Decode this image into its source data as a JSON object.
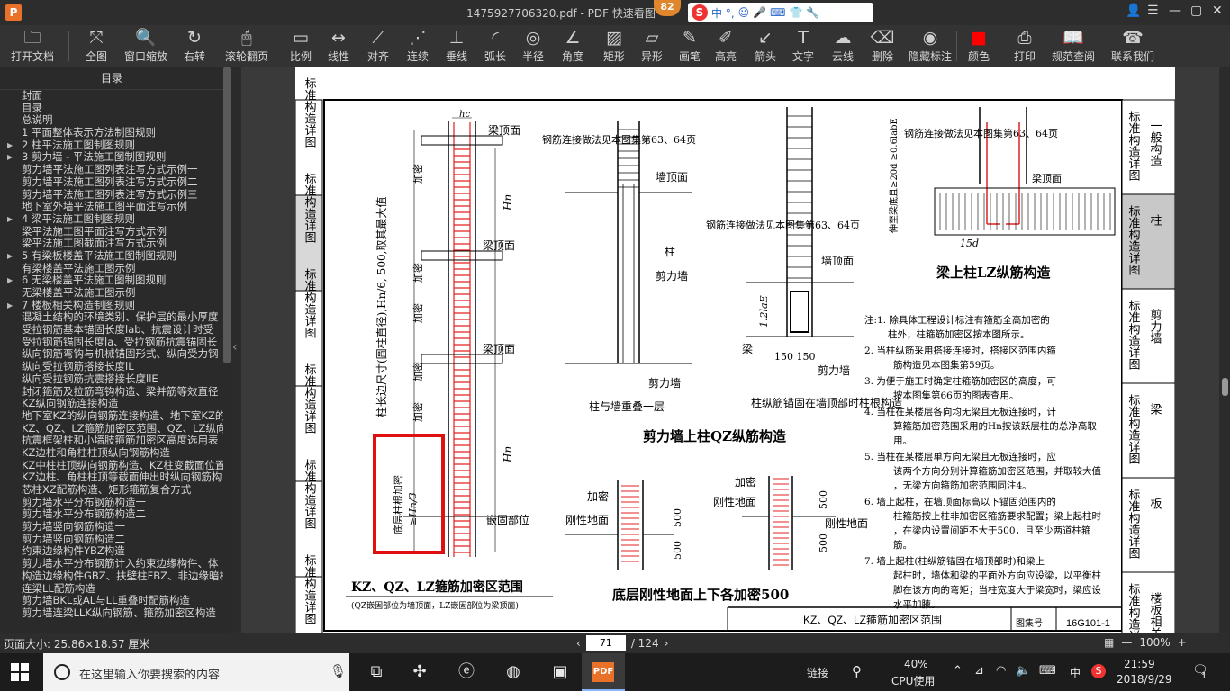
{
  "titlebar": {
    "app_letter": "P",
    "title": "1475927706320.pdf - PDF 快速看图",
    "badge": "82",
    "ime_logo": "S",
    "ime_text": "中 °,"
  },
  "toolbar": {
    "items": [
      {
        "label": "打开文档",
        "icon": "folder-icon",
        "glyph": "🗀"
      },
      {
        "label": "全图",
        "icon": "fit-page-icon",
        "glyph": "⤧"
      },
      {
        "label": "窗口缩放",
        "icon": "zoom-icon",
        "glyph": "🔍"
      },
      {
        "label": "右转",
        "icon": "rotate-right-icon",
        "glyph": "↻"
      },
      {
        "label": "滚轮翻页",
        "icon": "mouse-wheel-icon",
        "glyph": "🖱"
      },
      {
        "label": "比例",
        "icon": "scale-icon",
        "glyph": "▭"
      },
      {
        "label": "线性",
        "icon": "linear-icon",
        "glyph": "↔"
      },
      {
        "label": "对齐",
        "icon": "align-icon",
        "glyph": "⟋"
      },
      {
        "label": "连续",
        "icon": "continuous-icon",
        "glyph": "⋰"
      },
      {
        "label": "垂线",
        "icon": "perpendicular-icon",
        "glyph": "⊥"
      },
      {
        "label": "弧长",
        "icon": "arc-length-icon",
        "glyph": "◜"
      },
      {
        "label": "半径",
        "icon": "radius-icon",
        "glyph": "◎"
      },
      {
        "label": "角度",
        "icon": "angle-icon",
        "glyph": "∠"
      },
      {
        "label": "矩形",
        "icon": "rectangle-icon",
        "glyph": "▨"
      },
      {
        "label": "异形",
        "icon": "irregular-shape-icon",
        "glyph": "▱"
      },
      {
        "label": "画笔",
        "icon": "pen-icon",
        "glyph": "✎"
      },
      {
        "label": "高亮",
        "icon": "highlighter-icon",
        "glyph": "✐"
      },
      {
        "label": "箭头",
        "icon": "arrow-icon",
        "glyph": "↙"
      },
      {
        "label": "文字",
        "icon": "text-icon",
        "glyph": "T"
      },
      {
        "label": "云线",
        "icon": "cloud-line-icon",
        "glyph": "☁"
      },
      {
        "label": "删除",
        "icon": "eraser-icon",
        "glyph": "⌫"
      },
      {
        "label": "隐藏标注",
        "icon": "hide-annotation-icon",
        "glyph": "◉"
      },
      {
        "label": "颜色",
        "icon": "color-icon",
        "glyph": "■"
      },
      {
        "label": "打印",
        "icon": "print-icon",
        "glyph": "⎙"
      },
      {
        "label": "规范查阅",
        "icon": "book-icon",
        "glyph": "📖"
      },
      {
        "label": "联系我们",
        "icon": "support-icon",
        "glyph": "☎"
      }
    ],
    "color_swatch": "#ff0000"
  },
  "sidebar": {
    "heading": "目录",
    "items": [
      {
        "label": "封面",
        "arrow": ""
      },
      {
        "label": "目录",
        "arrow": ""
      },
      {
        "label": "总说明",
        "arrow": ""
      },
      {
        "label": "1 平面整体表示方法制图规则",
        "arrow": ""
      },
      {
        "label": "2 柱平法施工图制图规则",
        "arrow": "▶"
      },
      {
        "label": "3 剪力墙 - 平法施工图制图规则",
        "arrow": "▶"
      },
      {
        "label": "剪力墙平法施工图列表注写方式示例一",
        "arrow": ""
      },
      {
        "label": "剪力墙平法施工图列表注写方式示例二",
        "arrow": ""
      },
      {
        "label": "剪力墙平法施工图列表注写方式示例三",
        "arrow": ""
      },
      {
        "label": "地下室外墙平法施工图平面注写示例",
        "arrow": ""
      },
      {
        "label": "4 梁平法施工图制图规则",
        "arrow": "▶"
      },
      {
        "label": "梁平法施工图平面注写方式示例",
        "arrow": ""
      },
      {
        "label": "梁平法施工图截面注写方式示例",
        "arrow": ""
      },
      {
        "label": "5 有梁板楼盖平法施工图制图规则",
        "arrow": "▶"
      },
      {
        "label": "有梁楼盖平法施工图示例",
        "arrow": ""
      },
      {
        "label": "6 无梁楼盖平法施工图制图规则",
        "arrow": "▶"
      },
      {
        "label": "无梁楼盖平法施工图示例",
        "arrow": ""
      },
      {
        "label": "7 楼板相关构造制图规则",
        "arrow": "▶"
      },
      {
        "label": "混凝土结构的环境类别、保护层的最小厚度",
        "arrow": ""
      },
      {
        "label": "受拉钢筋基本锚固长度lab、抗震设计时受",
        "arrow": ""
      },
      {
        "label": "受拉钢筋锚固长度la、受拉钢筋抗震锚固长",
        "arrow": ""
      },
      {
        "label": "纵向钢筋弯钩与机械锚固形式、纵向受力钢",
        "arrow": ""
      },
      {
        "label": "纵向受拉钢筋搭接长度lL",
        "arrow": ""
      },
      {
        "label": "纵向受拉钢筋抗震搭接长度llE",
        "arrow": ""
      },
      {
        "label": "封闭箍筋及拉筋弯钩构造、梁并筋等效直径",
        "arrow": ""
      },
      {
        "label": "KZ纵向钢筋连接构造",
        "arrow": ""
      },
      {
        "label": "地下室KZ的纵向钢筋连接构造、地下室KZ的",
        "arrow": ""
      },
      {
        "label": "KZ、QZ、LZ箍筋加密区范围、QZ、LZ纵向钢筋",
        "arrow": ""
      },
      {
        "label": "抗震框架柱和小墙肢箍筋加密区高度选用表",
        "arrow": ""
      },
      {
        "label": "KZ边柱和角柱柱顶纵向钢筋构造",
        "arrow": ""
      },
      {
        "label": "KZ中柱柱顶纵向钢筋构造、KZ柱变截面位置",
        "arrow": ""
      },
      {
        "label": "KZ边柱、角柱柱顶等截面伸出时纵向钢筋构",
        "arrow": ""
      },
      {
        "label": "芯柱XZ配筋构造、矩形箍筋复合方式",
        "arrow": ""
      },
      {
        "label": "剪力墙水平分布钢筋构造一",
        "arrow": ""
      },
      {
        "label": "剪力墙水平分布钢筋构造二",
        "arrow": ""
      },
      {
        "label": "剪力墙竖向钢筋构造一",
        "arrow": ""
      },
      {
        "label": "剪力墙竖向钢筋构造二",
        "arrow": ""
      },
      {
        "label": "约束边缘构件YBZ构造",
        "arrow": ""
      },
      {
        "label": "剪力墙水平分布钢筋计入约束边缘构件、体",
        "arrow": ""
      },
      {
        "label": "构造边缘构件GBZ、扶壁柱FBZ、非边缘暗柱",
        "arrow": ""
      },
      {
        "label": "连梁LL配筋构造",
        "arrow": ""
      },
      {
        "label": "剪力墙BKL或AL与LL重叠时配筋构造",
        "arrow": ""
      },
      {
        "label": "剪力墙连梁LLK纵向钢筋、箍筋加密区构造",
        "arrow": ""
      }
    ]
  },
  "drawing": {
    "right_tabs": [
      {
        "main": "标准构造详图",
        "sub": "一般构造"
      },
      {
        "main": "标准构造详图",
        "sub": "柱"
      },
      {
        "main": "标准构造详图",
        "sub": "剪力墙"
      },
      {
        "main": "标准构造详图",
        "sub": "梁"
      },
      {
        "main": "标准构造详图",
        "sub": "板"
      },
      {
        "main": "标准构造详图",
        "sub": "楼板相关"
      }
    ],
    "left_tabs": [
      "标准构造详图",
      "标准构造详图",
      "标准构造详图",
      "标准构造详图",
      "标准构造详图",
      "标准构造详图"
    ],
    "labels": {
      "hc": "hc",
      "beam_top": "梁顶面",
      "beam_top_2": "梁顶面",
      "beam_top_3": "梁顶面",
      "dense": "加密",
      "hn": "Hn",
      "long_vertical": "柱长边尺寸(圆柱直径),Hn/6, 500,取其最大值",
      "bottom_col": "底层柱根加密",
      "hn3": "≥Hn/3",
      "anchor": "嵌固部位",
      "title_1": "KZ、QZ、LZ箍筋加密区范围",
      "note_1": "(QZ嵌固部位为墙顶面，LZ嵌固部位为梁顶面)",
      "rebar_note_a": "钢筋连接做法见本图集第63、64页",
      "wall_top": "墙顶面",
      "col": "柱",
      "shear_wall": "剪力墙",
      "caption_a": "柱与墙重叠一层",
      "rebar_note_b": "钢筋连接做法见本图集第63、64页",
      "wall_top_b": "墙顶面",
      "len_b": "1.2laE",
      "beam": "梁",
      "dims_b": "150 150",
      "caption_b": "柱纵筋锚固在墙顶部时柱根构造",
      "title_2": "剪力墙上柱QZ纵筋构造",
      "rebar_note_c": "钢筋连接做法见本图集第63、64页",
      "beam_top_c": "梁顶面",
      "extend_c": "伸至梁底且≥20d ≥0.6labE",
      "d15": "15d",
      "title_3": "梁上柱LZ纵筋构造",
      "dense_a": "加密",
      "rigid_a": "刚性地面",
      "d500a": "500",
      "d500b": "500",
      "dense_b": "加密",
      "rigid_b": "刚性地面",
      "d500c": "500",
      "rigid_c": "刚性地面",
      "d500d": "500",
      "title_4": "底层刚性地面上下各加密500",
      "title_block": "KZ、QZ、LZ箍筋加密区范围",
      "atlas_no_label": "图集号",
      "atlas_no": "16G101-1"
    },
    "notes": [
      "注:1. 除具体工程设计标注有箍筋全高加密的柱外，柱箍筋加密区按本图所示。",
      "2. 当柱纵筋采用搭接连接时，搭接区范围内箍筋构造见本图集第59页。",
      "3. 为便于施工时确定柱箍筋加密区的高度，可按本图集第66页的图表查用。",
      "4. 当柱在某楼层各向均无梁且无板连接时，计算箍筋加密范围采用的Hn按该跃层柱的总净高取用。",
      "5. 当柱在某楼层单方向无梁且无板连接时，应该两个方向分别计算箍筋加密区范围，并取较大值，无梁方向箍筋加密范围同注4。",
      "6. 墙上起柱，在墙顶面标高以下锚固范围内的柱箍筋按上柱非加密区箍筋要求配置；梁上起柱时，在梁内设置间距不大于500，且至少两道柱箍筋。",
      "7. 墙上起柱(柱纵筋锚固在墙顶部时)和梁上起柱时，墙体和梁的平面外方向应设梁，以平衡柱脚在该方向的弯矩；当柱宽度大于梁宽时，梁应设水平加腋。"
    ],
    "highlight_color": "#e01010",
    "rebar_color": "#e02020"
  },
  "statusbar": {
    "page_size": "页面大小: 25.86×18.57 厘米",
    "current_page": "71",
    "total_pages": "/ 124",
    "zoom": "100%"
  },
  "taskbar": {
    "search_placeholder": "在这里输入你要搜索的内容",
    "link_label": "链接",
    "cpu_percent": "40%",
    "cpu_label": "CPU使用",
    "lang": "中",
    "time": "21:59",
    "date": "2018/9/29",
    "notif_count": "1"
  }
}
